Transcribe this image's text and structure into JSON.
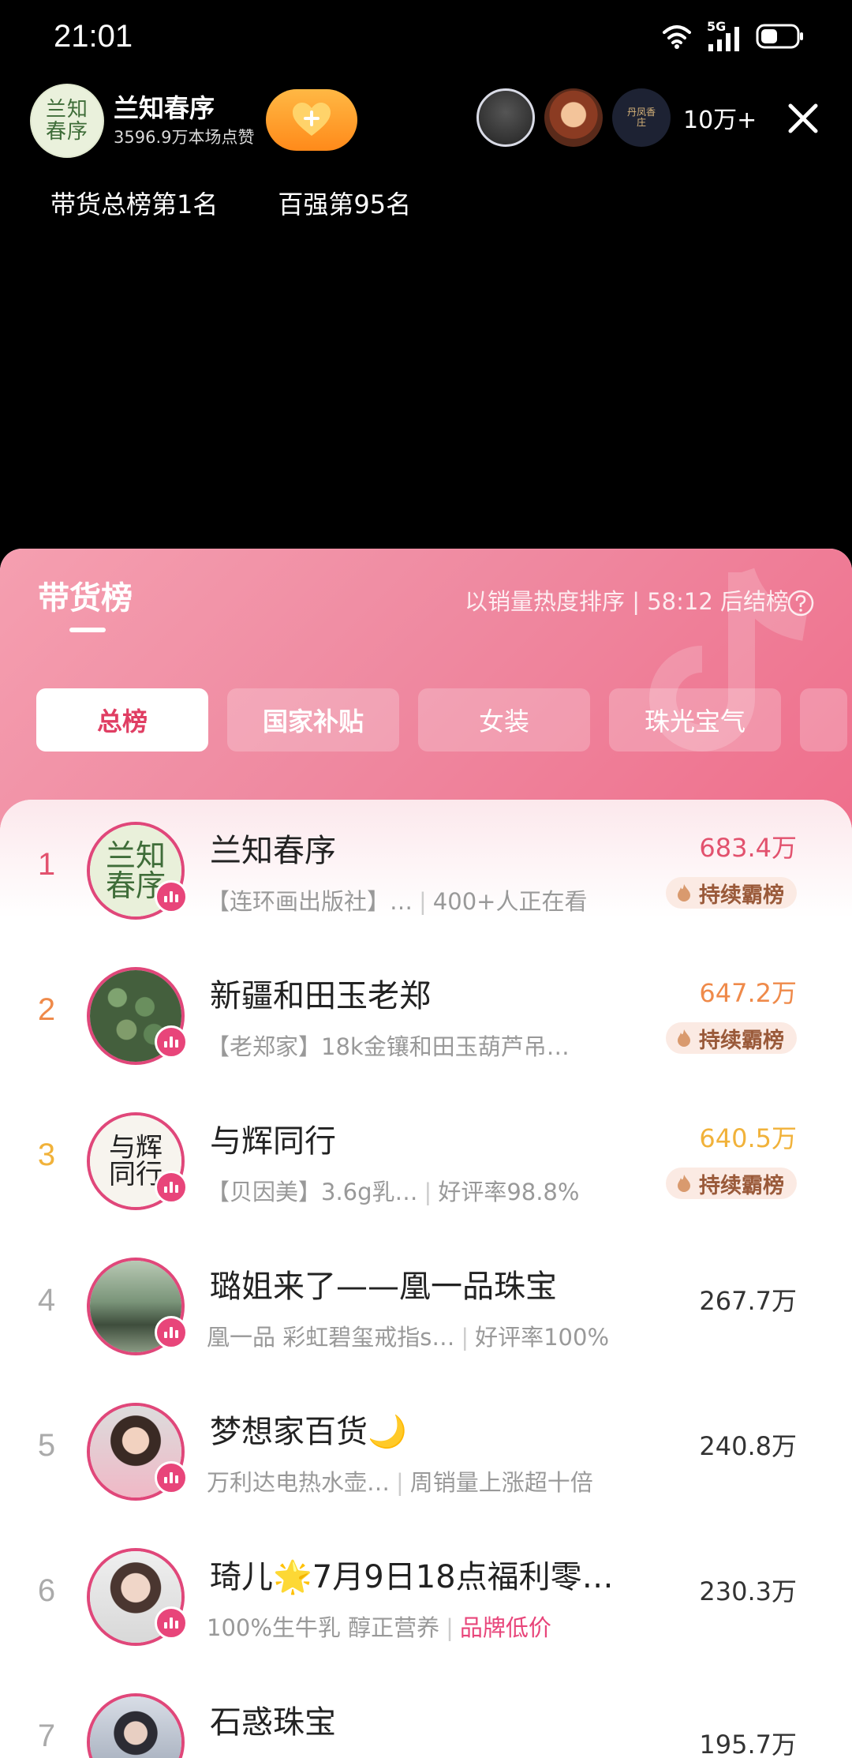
{
  "status_bar": {
    "time": "21:01",
    "network": "5G"
  },
  "live_header": {
    "host_name": "兰知春序",
    "host_likes": "3596.9万本场点赞",
    "host_logo_text": [
      "兰知",
      "春序"
    ],
    "viewer_count": "10万+",
    "viewer3_text": "丹凤香庄",
    "rank_tags": [
      "带货总榜第1名",
      "百强第95名"
    ]
  },
  "panel": {
    "title": "带货榜",
    "sort_info": "以销量热度排序 | 58:12 后结榜",
    "tabs": [
      {
        "label": "总榜",
        "active": true
      },
      {
        "label": "国家补贴",
        "active": false
      },
      {
        "label": "女装",
        "active": false
      },
      {
        "label": "珠光宝气",
        "active": false
      }
    ]
  },
  "colors": {
    "accent": "#e8457a",
    "rank1": "#e2526e",
    "rank2": "#ef8a4a",
    "rank3": "#f1b23a"
  },
  "ranking": [
    {
      "rank": "1",
      "name": "兰知春序",
      "product": "【连环画出版社】…",
      "extra": "400+人正在看",
      "value": "683.4万",
      "badge": "持续霸榜",
      "avatar_text": [
        "兰知",
        "春序"
      ]
    },
    {
      "rank": "2",
      "name": "新疆和田玉老郑",
      "product": "【老郑家】18k金镶和田玉葫芦吊…",
      "extra": "",
      "value": "647.2万",
      "badge": "持续霸榜"
    },
    {
      "rank": "3",
      "name": "与辉同行",
      "product": "【贝因美】3.6g乳…",
      "extra": "好评率98.8%",
      "value": "640.5万",
      "badge": "持续霸榜",
      "avatar_text": [
        "与辉",
        "同行"
      ]
    },
    {
      "rank": "4",
      "name": "璐姐来了——凰一品珠宝",
      "product": "凰一品 彩虹碧玺戒指s…",
      "extra": "好评率100%",
      "value": "267.7万"
    },
    {
      "rank": "5",
      "name": "梦想家百货🌙",
      "product": "万利达电热水壶…",
      "extra": "周销量上涨超十倍",
      "value": "240.8万"
    },
    {
      "rank": "6",
      "name": "琦儿🌟7月9日18点福利零…",
      "product": "100%生牛乳 醇正营养",
      "extra": "品牌低价",
      "value": "230.3万"
    },
    {
      "rank": "7",
      "name": "石惑珠宝",
      "product": "",
      "extra": "",
      "value": "195.7万"
    }
  ]
}
